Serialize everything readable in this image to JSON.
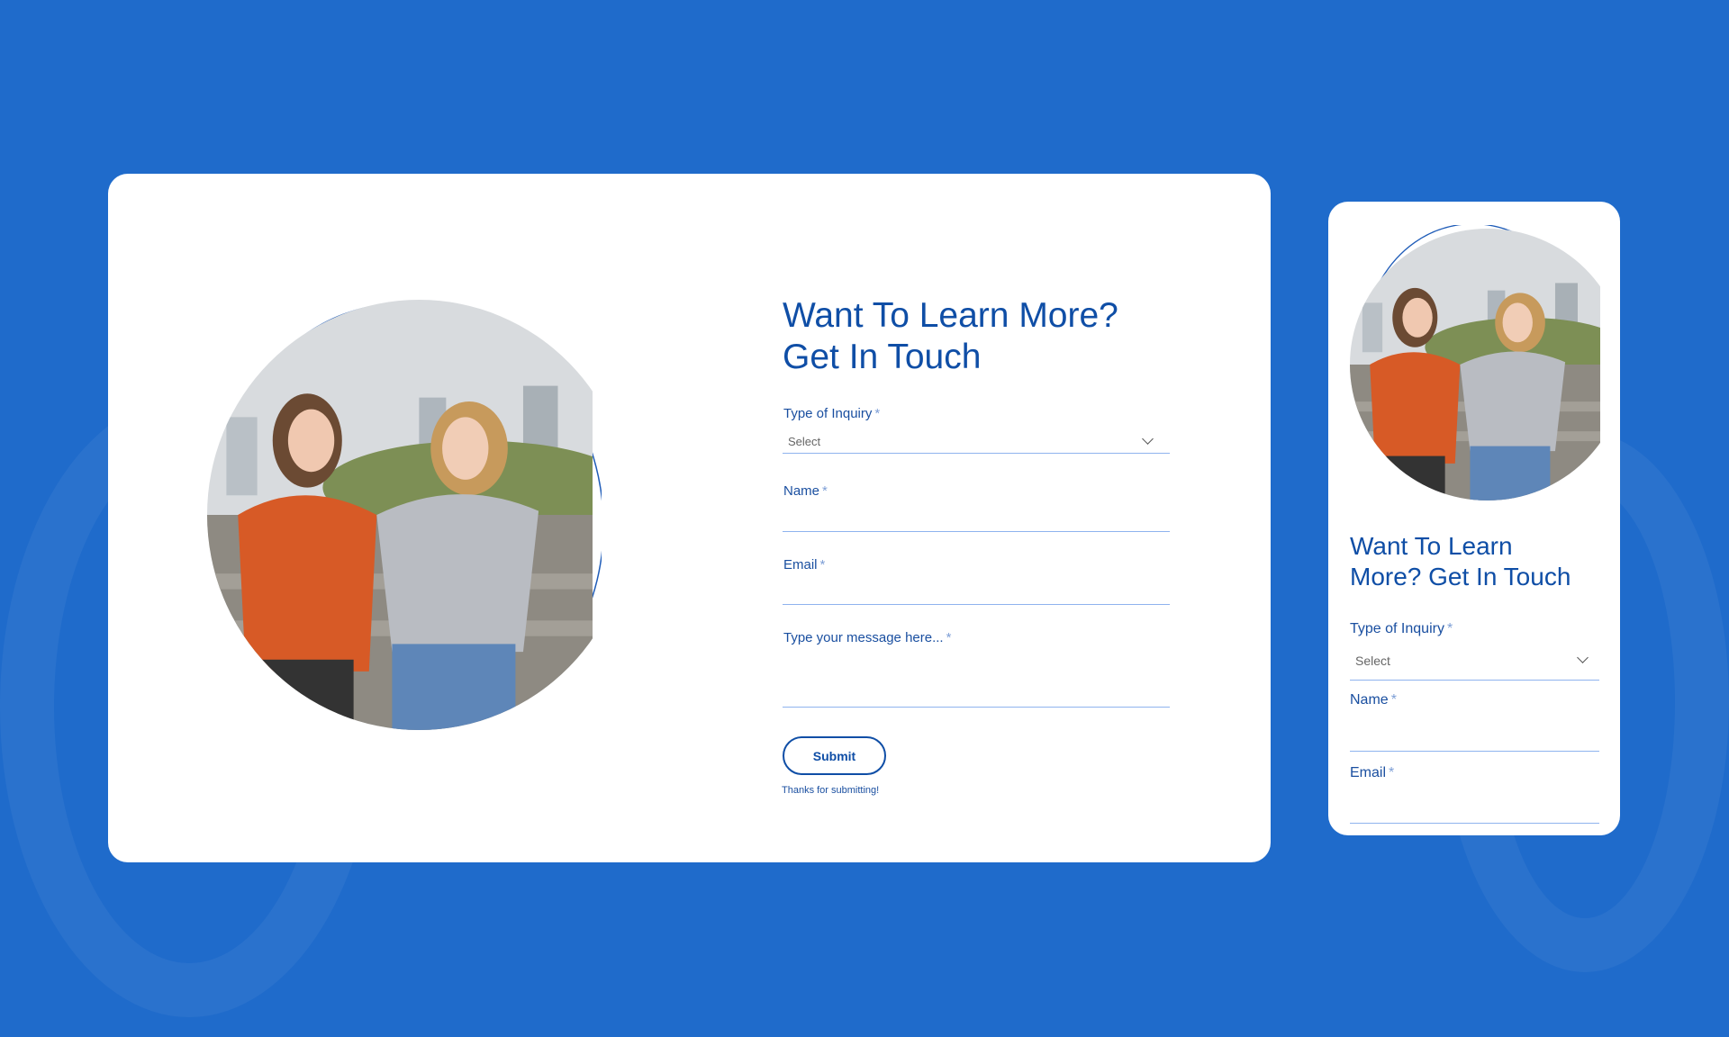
{
  "colors": {
    "background": "#1f6bcb",
    "accent": "#0f4ea6"
  },
  "desktop": {
    "title_line1": "Want To Learn More?",
    "title_line2": "Get In Touch",
    "inquiry_label": "Type of Inquiry",
    "inquiry_value": "Select",
    "name_label": "Name",
    "email_label": "Email",
    "message_label": "Type your message here...",
    "required": "*",
    "submit": "Submit",
    "thanks": "Thanks for submitting!"
  },
  "mobile": {
    "title_line1": "Want To Learn",
    "title_line2": "More? Get In Touch",
    "inquiry_label": "Type of Inquiry",
    "inquiry_value": "Select",
    "name_label": "Name",
    "email_label": "Email",
    "required": "*"
  }
}
